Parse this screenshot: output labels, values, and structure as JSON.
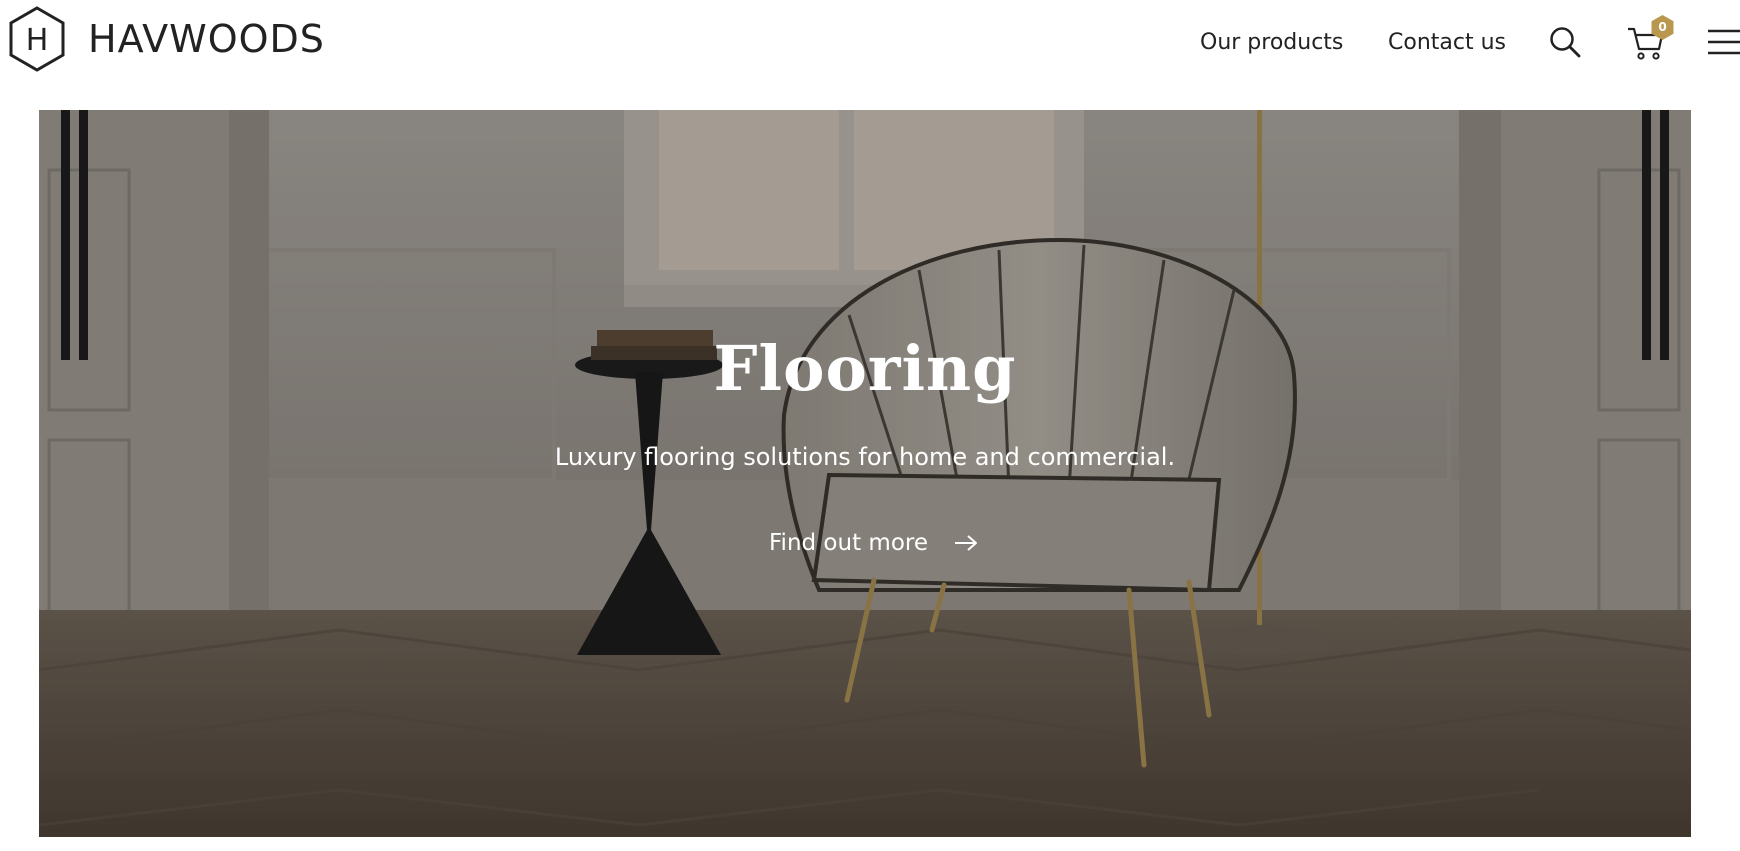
{
  "brand": {
    "name": "HAVWOODS",
    "monogram": "H"
  },
  "nav": {
    "products_label": "Our products",
    "contact_label": "Contact us",
    "search_icon": "search-icon",
    "cart_icon": "cart-icon",
    "cart_count": "0",
    "menu_icon": "hamburger-menu-icon"
  },
  "hero": {
    "title": "Flooring",
    "subtitle": "Luxury flooring solutions for home and commercial.",
    "cta_label": "Find out more",
    "cta_icon": "arrow-right-icon"
  },
  "colors": {
    "badge_gold": "#b9974f",
    "text_dark": "#222222",
    "overlay_text": "#ffffff"
  }
}
